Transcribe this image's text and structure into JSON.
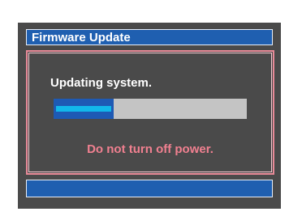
{
  "title_bar": {
    "title": "Firmware Update"
  },
  "content": {
    "status": "Updating system.",
    "progress": {
      "fraction": 0.31
    },
    "warning": "Do not turn off power."
  },
  "colors": {
    "screen_background": "#4a4a4a",
    "bar_blue": "#1f5fb0",
    "progress_track": "#c4c4c4",
    "progress_fill": "#12b8ea",
    "warning_text": "#f08090",
    "panel_border": "#e88a98"
  }
}
